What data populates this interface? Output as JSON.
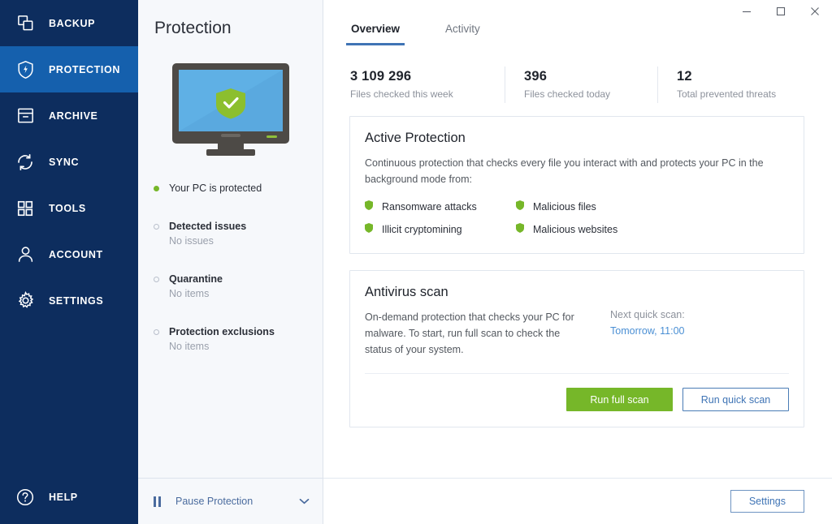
{
  "sidebar": {
    "items": [
      {
        "label": "BACKUP",
        "icon": "backup-icon",
        "active": false
      },
      {
        "label": "PROTECTION",
        "icon": "shield-bolt-icon",
        "active": true
      },
      {
        "label": "ARCHIVE",
        "icon": "archive-icon",
        "active": false
      },
      {
        "label": "SYNC",
        "icon": "sync-icon",
        "active": false
      },
      {
        "label": "TOOLS",
        "icon": "tools-grid-icon",
        "active": false
      },
      {
        "label": "ACCOUNT",
        "icon": "person-icon",
        "active": false
      },
      {
        "label": "SETTINGS",
        "icon": "gear-icon",
        "active": false
      }
    ],
    "help": {
      "label": "HELP",
      "icon": "question-circle-icon"
    },
    "colors": {
      "background": "#0d2d5e",
      "active": "#1560ad",
      "text": "#ffffff"
    }
  },
  "middle": {
    "title": "Protection",
    "illustration": "monitor-with-shield",
    "status": {
      "label": "Your PC is protected",
      "dot_color": "#76b729"
    },
    "sections": [
      {
        "title": "Detected issues",
        "value": "No issues"
      },
      {
        "title": "Quarantine",
        "value": "No items"
      },
      {
        "title": "Protection exclusions",
        "value": "No items"
      }
    ],
    "pause": {
      "label": "Pause Protection",
      "icon": "pause-icon",
      "chevron": "chevron-down-icon"
    }
  },
  "window": {
    "minimize": "─",
    "maximize": "□",
    "close": "✕"
  },
  "main": {
    "tabs": [
      {
        "label": "Overview",
        "active": true
      },
      {
        "label": "Activity",
        "active": false
      }
    ],
    "stats": [
      {
        "value": "3 109 296",
        "label": "Files checked this week"
      },
      {
        "value": "396",
        "label": "Files checked today"
      },
      {
        "value": "12",
        "label": "Total prevented threats"
      }
    ],
    "active_protection": {
      "title": "Active Protection",
      "description": "Continuous protection that checks every file you interact with and protects your PC in the background mode from:",
      "features": [
        "Ransomware attacks",
        "Malicious files",
        "Illicit cryptomining",
        "Malicious websites"
      ],
      "bullet_color": "#76b729"
    },
    "antivirus": {
      "title": "Antivirus scan",
      "description": "On-demand protection that checks your PC for malware. To start, run full scan to check the status of your system.",
      "next_scan_label": "Next quick scan:",
      "next_scan_value": "Tomorrow, 11:00",
      "primary_button": "Run full scan",
      "secondary_button": "Run quick scan"
    },
    "footer": {
      "settings_button": "Settings"
    }
  }
}
